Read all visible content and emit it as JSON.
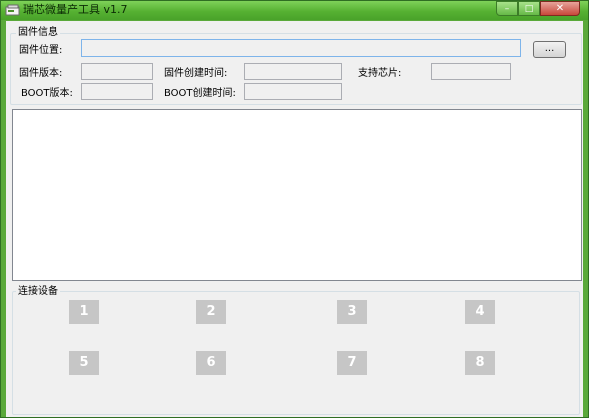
{
  "window": {
    "title": "瑞芯微量产工具 v1.7",
    "minimize_glyph": "–",
    "maximize_glyph": "□",
    "close_glyph": "✕"
  },
  "firmware_info": {
    "group_label": "固件信息",
    "location_label": "固件位置:",
    "location_value": "",
    "browse_label": "...",
    "version_label": "固件版本:",
    "version_value": "",
    "created_label": "固件创建时间:",
    "created_value": "",
    "chip_label": "支持芯片:",
    "chip_value": "",
    "boot_version_label": "BOOT版本:",
    "boot_version_value": "",
    "boot_created_label": "BOOT创建时间:",
    "boot_created_value": ""
  },
  "log": {
    "content": ""
  },
  "devices": {
    "group_label": "连接设备",
    "buttons": [
      "1",
      "2",
      "3",
      "4",
      "5",
      "6",
      "7",
      "8"
    ]
  },
  "colors": {
    "titlebar": "#56b132",
    "client_bg": "#f0f0f0",
    "device_button": "#c6c6c6"
  },
  "icons": {
    "app": "app-icon"
  }
}
